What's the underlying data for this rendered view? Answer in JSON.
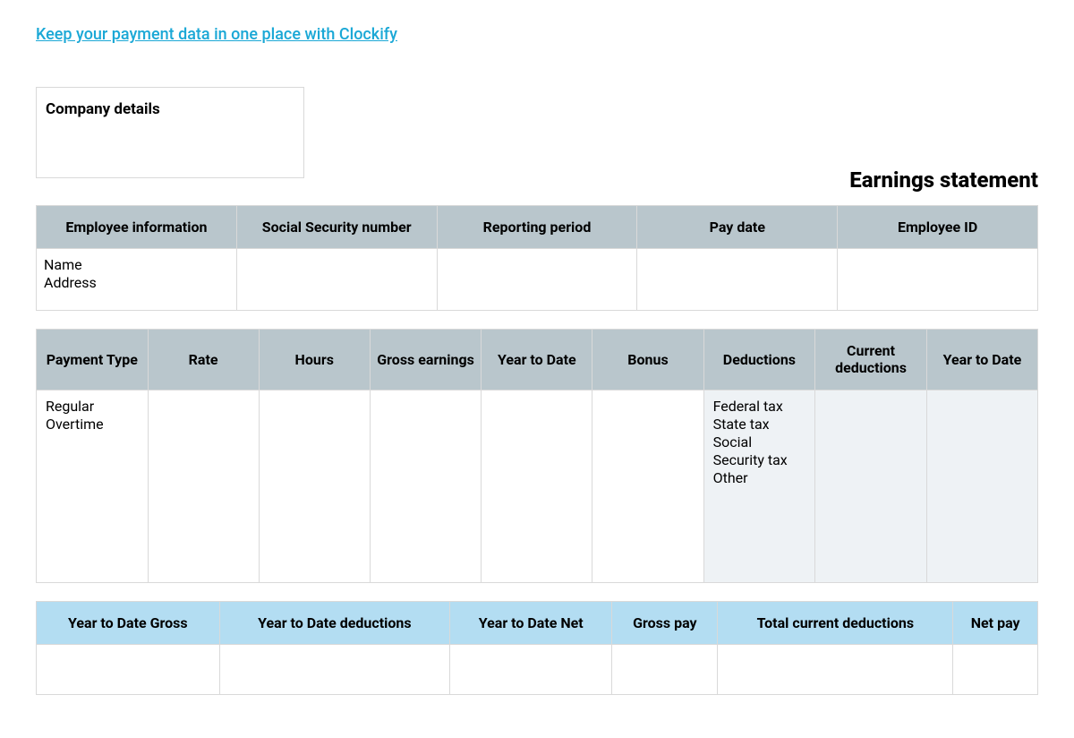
{
  "link_text": "Keep your payment data in one place with Clockify",
  "company_label": "Company details",
  "title": "Earnings statement",
  "emp_headers": [
    "Employee information",
    "Social Security number",
    "Reporting period",
    "Pay date",
    "Employee ID"
  ],
  "emp_row": {
    "name": "Name",
    "address": "Address"
  },
  "payment_headers": [
    "Payment Type",
    "Rate",
    "Hours",
    "Gross earnings",
    "Year to Date",
    "Bonus",
    "Deductions",
    "Current deductions",
    "Year to Date"
  ],
  "payment_types": [
    "Regular",
    "Overtime"
  ],
  "deductions_list": [
    "Federal tax",
    "State tax",
    "Social Security tax",
    "Other"
  ],
  "totals_headers": [
    "Year to Date Gross",
    "Year to Date deductions",
    "Year to Date Net",
    "Gross pay",
    "Total current deductions",
    "Net pay"
  ]
}
